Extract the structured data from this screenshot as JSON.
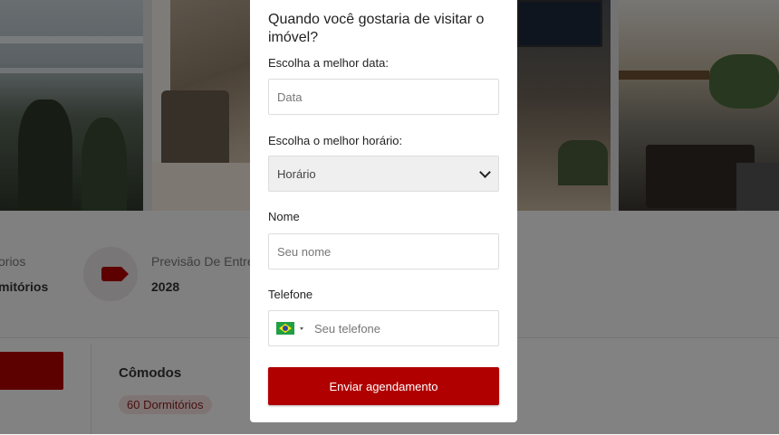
{
  "background": {
    "info": [
      {
        "label": "orios",
        "value": "mitórios"
      },
      {
        "label": "Previsão De Entre",
        "value": "2028"
      }
    ],
    "tag_icon": "tag-icon",
    "rooms": {
      "title": "Cômodos",
      "chip": "60 Dormitórios"
    }
  },
  "modal": {
    "title": "Quando você gostaria de visitar o imóvel?",
    "date": {
      "label": "Escolha a melhor data:",
      "placeholder": "Data"
    },
    "time": {
      "label": "Escolha o melhor horário:",
      "selected": "Horário"
    },
    "name": {
      "label": "Nome",
      "placeholder": "Seu nome"
    },
    "phone": {
      "label": "Telefone",
      "placeholder": "Seu telefone",
      "country_icon": "brazil-flag-icon"
    },
    "submit_label": "Enviar agendamento"
  },
  "colors": {
    "accent": "#b00000",
    "overlay": "rgba(0,0,0,0.48)"
  }
}
